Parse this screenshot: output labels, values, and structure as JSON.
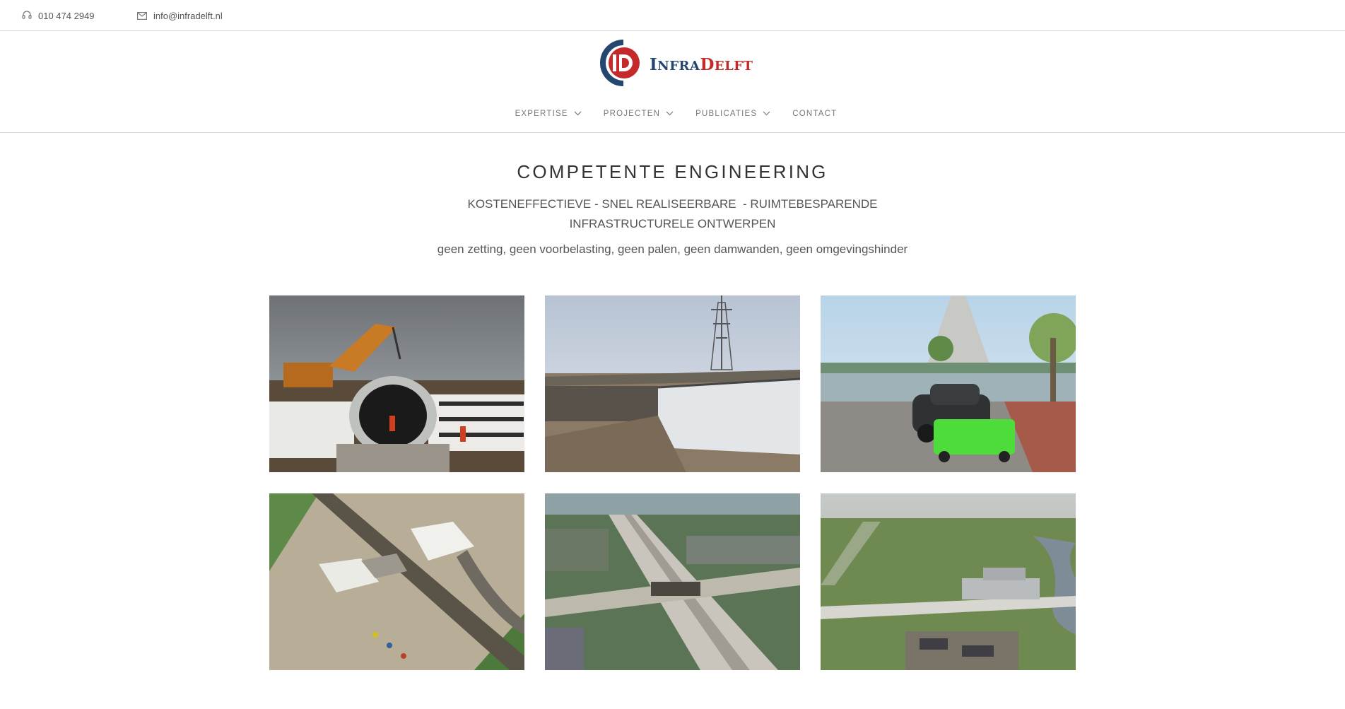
{
  "topbar": {
    "phone_icon": "headset-icon",
    "phone": "010 474 2949",
    "email_icon": "envelope-icon",
    "email": "info@infradelft.nl"
  },
  "header": {
    "logo": {
      "word1": "InfraDelft",
      "monogram": "ID",
      "brand_colors": [
        "#24466f",
        "#c42a2a"
      ]
    },
    "nav": [
      {
        "label": "EXPERTISE",
        "dropdown": true
      },
      {
        "label": "PROJECTEN",
        "dropdown": true
      },
      {
        "label": "PUBLICATIES",
        "dropdown": true
      },
      {
        "label": "CONTACT",
        "dropdown": false
      }
    ]
  },
  "intro": {
    "headline": "COMPETENTE ENGINEERING",
    "subline_1": "KOSTENEFFECTIEVE - SNEL REALISEERBARE  - RUIMTEBESPARENDE",
    "subline_2": "INFRASTRUCTURELE ONTWERPEN",
    "tagline": "geen zetting, geen voorbelasting, geen palen, geen damwanden, geen omgevingshinder"
  },
  "gallery": [
    {
      "subject": "excavator and culvert pipe among EPS blocks"
    },
    {
      "subject": "bridge abutment with EPS wall and power pylon"
    },
    {
      "subject": "green mobile unit on road near cone building"
    },
    {
      "subject": "aerial view construction site near railway"
    },
    {
      "subject": "aerial view highway and viaduct construction"
    },
    {
      "subject": "aerial view polder landscape with road works"
    }
  ],
  "colors": {
    "divider": "#d6d6d6",
    "text_dark": "#333333",
    "text_muted": "#777777"
  }
}
